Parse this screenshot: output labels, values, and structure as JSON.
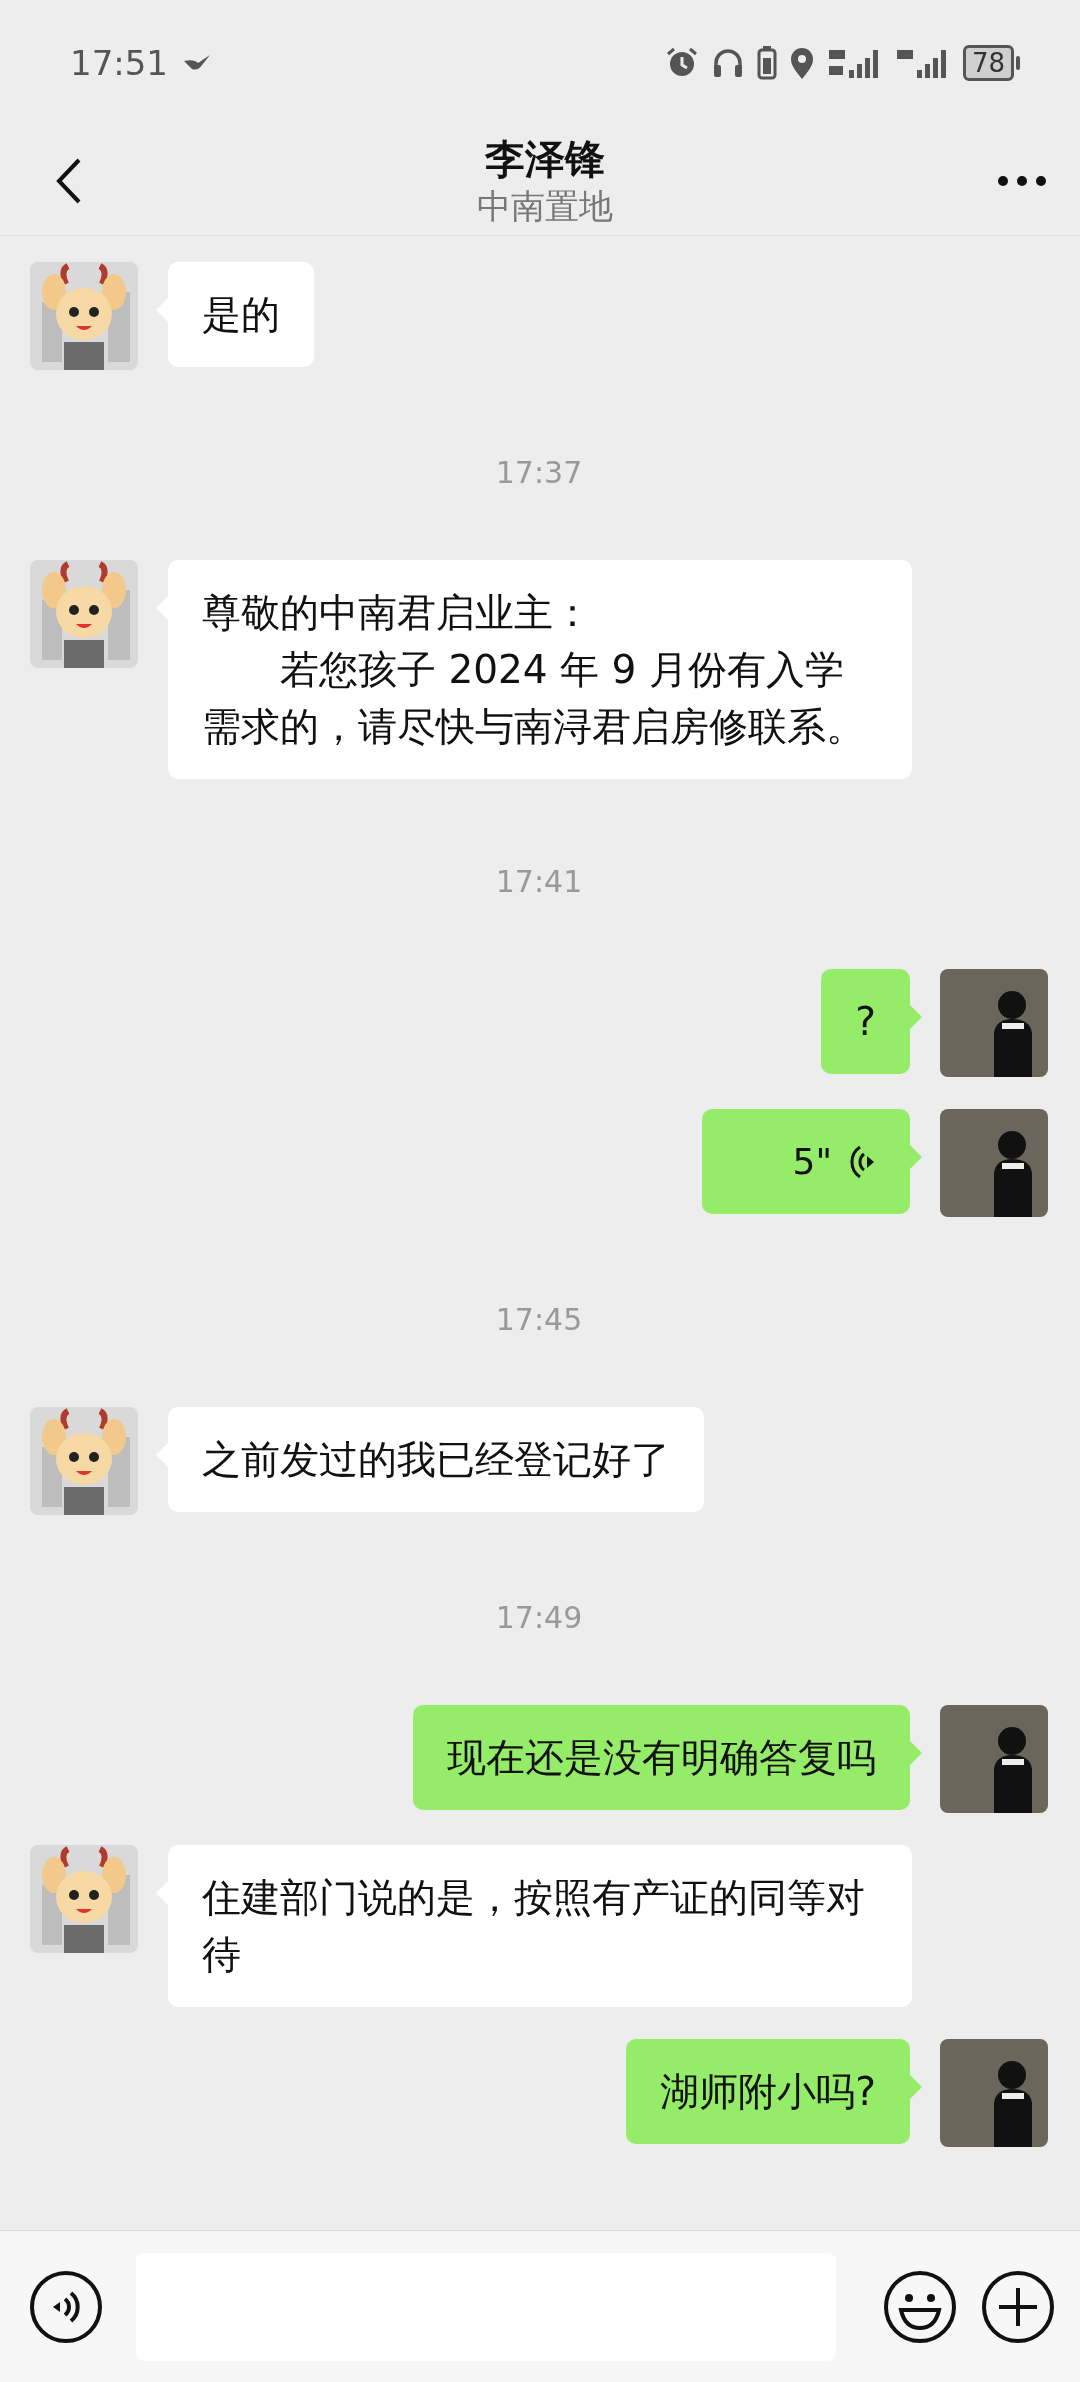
{
  "status_bar": {
    "time": "17:51",
    "battery": "78"
  },
  "header": {
    "title": "李泽锋",
    "subtitle": "中南置地"
  },
  "messages": [
    {
      "kind": "text",
      "outgoing": false,
      "paragraphs": [
        "是的"
      ]
    },
    {
      "kind": "time",
      "text": "17:37"
    },
    {
      "kind": "text",
      "outgoing": false,
      "paragraphs": [
        "尊敬的中南君启业主：",
        "　　若您孩子 2024 年 9 月份有入学需求的，请尽快与南浔君启房修联系。"
      ]
    },
    {
      "kind": "time",
      "text": "17:41"
    },
    {
      "kind": "text",
      "outgoing": true,
      "paragraphs": [
        "?"
      ]
    },
    {
      "kind": "voice",
      "outgoing": true,
      "duration": "5\""
    },
    {
      "kind": "time",
      "text": "17:45"
    },
    {
      "kind": "text",
      "outgoing": false,
      "paragraphs": [
        "之前发过的我已经登记好了"
      ]
    },
    {
      "kind": "time",
      "text": "17:49"
    },
    {
      "kind": "text",
      "outgoing": true,
      "paragraphs": [
        "现在还是没有明确答复吗"
      ]
    },
    {
      "kind": "text",
      "outgoing": false,
      "paragraphs": [
        "住建部门说的是，按照有产证的同等对待"
      ]
    },
    {
      "kind": "text",
      "outgoing": true,
      "paragraphs": [
        "湖师附小吗?"
      ]
    }
  ]
}
